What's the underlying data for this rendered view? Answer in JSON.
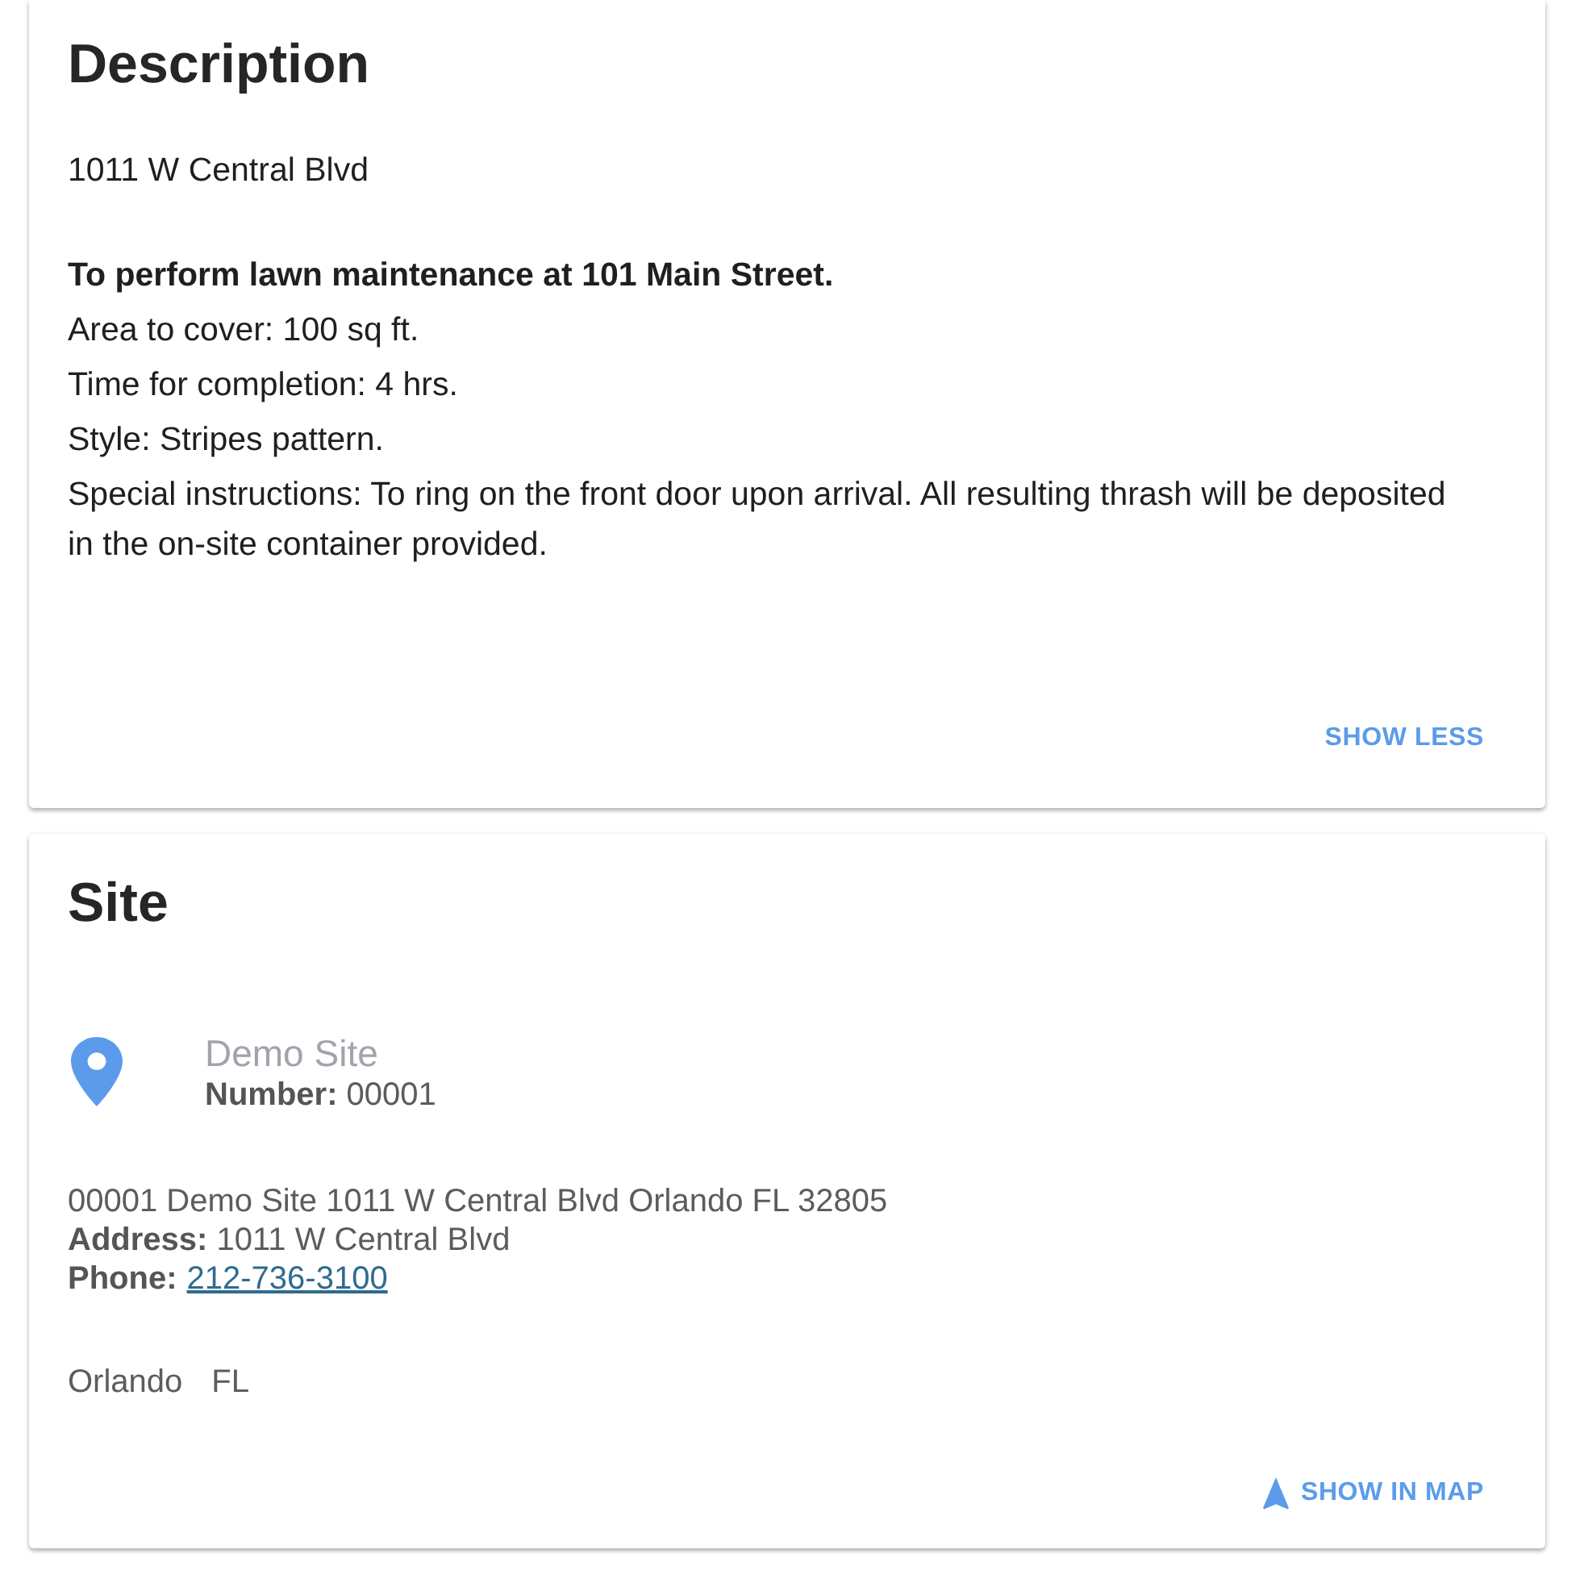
{
  "description": {
    "title": "Description",
    "address": "1011 W Central Blvd",
    "paragraphs": [
      {
        "text": "To perform lawn maintenance at 101 Main Street.",
        "bold": true
      },
      {
        "text": "Area to cover: 100 sq ft.",
        "bold": false
      },
      {
        "text": "Time for completion: 4 hrs.",
        "bold": false
      },
      {
        "text": "Style: Stripes pattern.",
        "bold": false
      },
      {
        "text": "Special instructions: To ring on the front door upon arrival. All resulting thrash will be deposited in the on-site container provided.",
        "bold": false
      }
    ],
    "button": "SHOW LESS"
  },
  "site": {
    "title": "Site",
    "name": "Demo Site",
    "number": "**Number:** 00001",
    "summary": "00001 Demo Site 1011 W Central Blvd Orlando FL 32805",
    "address": "**Address:** 1011 W Central Blvd",
    "phone": {
      "label": "Phone:",
      "value": "212-736-3100"
    },
    "city": "Orlando",
    "state": "FL",
    "button": "SHOW IN MAP"
  }
}
